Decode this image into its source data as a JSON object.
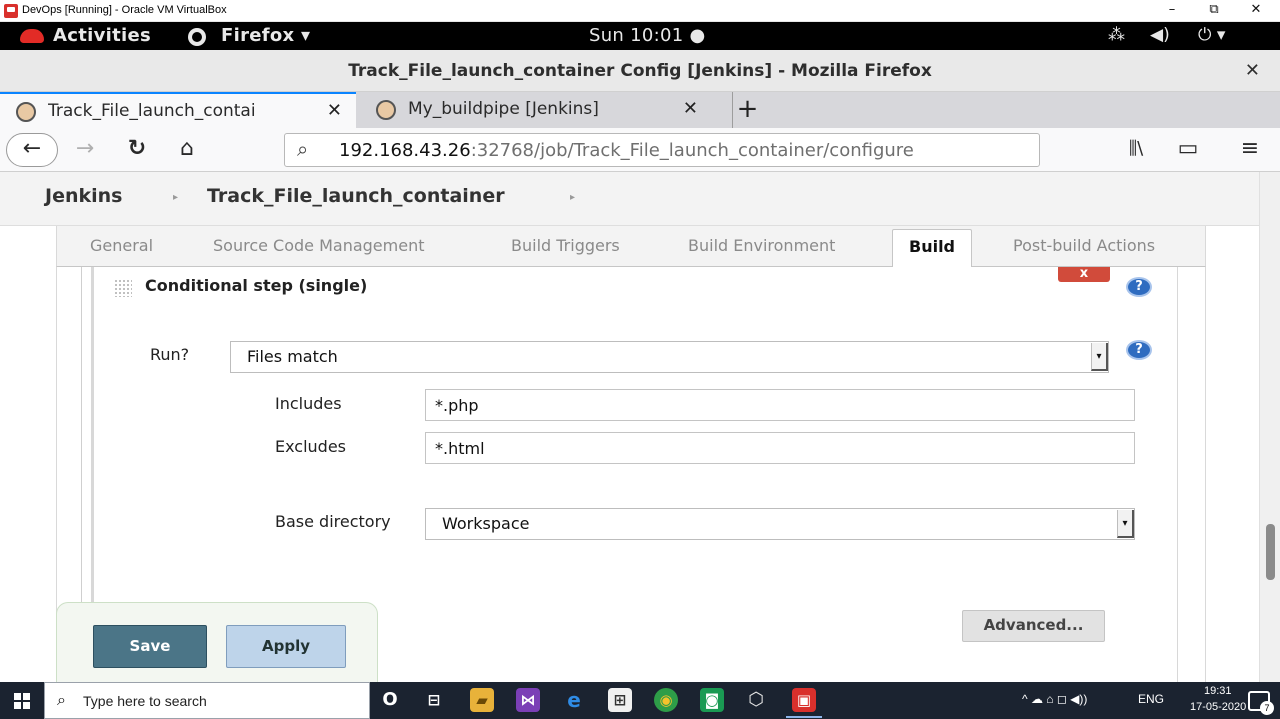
{
  "vbox": {
    "title": "DevOps [Running] - Oracle VM VirtualBox",
    "min": "–",
    "restore": "⧉",
    "close": "✕"
  },
  "gnome": {
    "activities": "Activities",
    "app": "Firefox ▾",
    "clock": "Sun 10:01 ●",
    "tray_network": "⁂",
    "tray_volume": "◀)",
    "tray_power": "⏻ ▾"
  },
  "firefox": {
    "window_title": "Track_File_launch_container Config [Jenkins] - Mozilla Firefox",
    "close": "✕",
    "tabs": [
      {
        "label": "Track_File_launch_contai",
        "close": "✕",
        "active": true
      },
      {
        "label": "My_buildpipe [Jenkins]",
        "close": "✕",
        "active": false
      }
    ],
    "new_tab": "+",
    "url_host": "192.168.43.26",
    "url_path": ":32768/job/Track_File_launch_container/configure",
    "back": "←",
    "forward": "→",
    "reload": "↻",
    "home": "⌂",
    "search_glyph": "⌕",
    "library": "⫼\\",
    "sidebar": "▭",
    "menu": "≡"
  },
  "breadcrumb": {
    "root": "Jenkins",
    "job": "Track_File_launch_container",
    "sep": "▸"
  },
  "config_tabs": [
    "General",
    "Source Code Management",
    "Build Triggers",
    "Build Environment",
    "Build",
    "Post-build Actions"
  ],
  "step": {
    "title": "Conditional step (single)",
    "delete": "x",
    "help": "?",
    "run_label": "Run?",
    "run_value": "Files match",
    "includes_label": "Includes",
    "includes_value": "*.php",
    "excludes_label": "Excludes",
    "excludes_value": "*.html",
    "basedir_label": "Base directory",
    "basedir_value": "Workspace",
    "advanced": "Advanced..."
  },
  "actions": {
    "save": "Save",
    "apply": "Apply"
  },
  "taskbar": {
    "search_placeholder": "Type here to search",
    "search_glyph": "⌕",
    "time": "19:31",
    "date": "17-05-2020",
    "lang": "ENG",
    "tray_icons": "^  ☁  ⌂  ◻  ◀))",
    "notifications": "7",
    "apps": [
      "O",
      "⊟",
      "▰",
      "⋈",
      "e",
      "⊞",
      "◉",
      "◙",
      "⬡",
      "▣"
    ]
  }
}
